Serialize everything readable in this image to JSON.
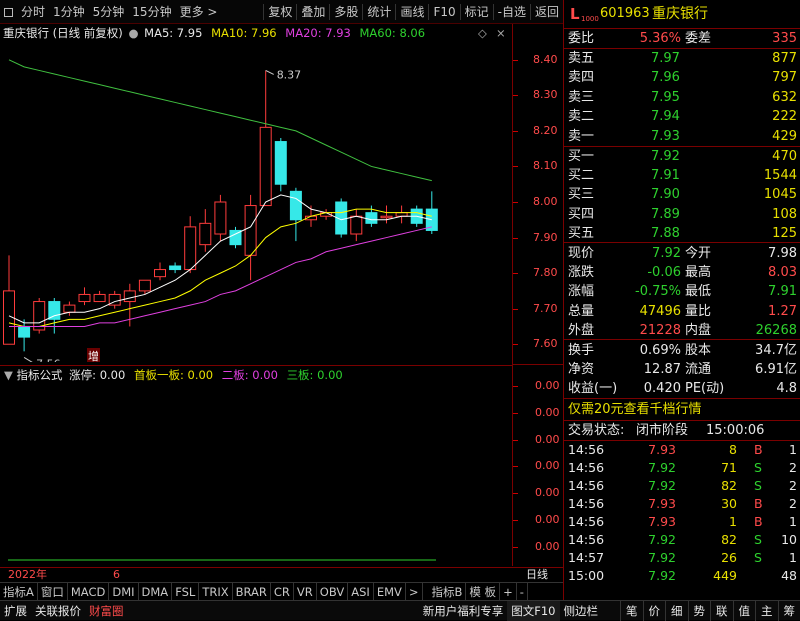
{
  "toolbar": {
    "items": [
      "分时",
      "1分钟",
      "5分钟",
      "15分钟",
      "更多 >",
      "复权",
      "叠加",
      "多股",
      "统计",
      "画线",
      "F10",
      "标记",
      "-自选",
      "返回"
    ]
  },
  "chart_header": {
    "title": "重庆银行 (日线 前复权)",
    "ma5": "MA5: 7.95",
    "ma10": "MA10: 7.96",
    "ma20": "MA20: 7.93",
    "ma60": "MA60: 8.06"
  },
  "chart_data": {
    "type": "candlestick",
    "price_ticks": [
      "8.40",
      "8.30",
      "8.20",
      "8.10",
      "8.00",
      "7.90",
      "7.80",
      "7.70",
      "7.60"
    ],
    "ylim": [
      7.55,
      8.45
    ],
    "candles": [
      {
        "o": 7.6,
        "c": 7.75,
        "h": 7.85,
        "l": 7.6
      },
      {
        "o": 7.65,
        "c": 7.62,
        "h": 7.67,
        "l": 7.58
      },
      {
        "o": 7.64,
        "c": 7.72,
        "h": 7.73,
        "l": 7.63
      },
      {
        "o": 7.72,
        "c": 7.67,
        "h": 7.73,
        "l": 7.63
      },
      {
        "o": 7.69,
        "c": 7.71,
        "h": 7.72,
        "l": 7.68
      },
      {
        "o": 7.72,
        "c": 7.74,
        "h": 7.76,
        "l": 7.71
      },
      {
        "o": 7.72,
        "c": 7.74,
        "h": 7.75,
        "l": 7.72
      },
      {
        "o": 7.71,
        "c": 7.74,
        "h": 7.75,
        "l": 7.7
      },
      {
        "o": 7.72,
        "c": 7.75,
        "h": 7.77,
        "l": 7.65
      },
      {
        "o": 7.75,
        "c": 7.78,
        "h": 7.78,
        "l": 7.74
      },
      {
        "o": 7.79,
        "c": 7.81,
        "h": 7.83,
        "l": 7.78
      },
      {
        "o": 7.82,
        "c": 7.81,
        "h": 7.83,
        "l": 7.8
      },
      {
        "o": 7.81,
        "c": 7.93,
        "h": 7.96,
        "l": 7.8
      },
      {
        "o": 7.88,
        "c": 7.94,
        "h": 7.98,
        "l": 7.86
      },
      {
        "o": 7.91,
        "c": 8.0,
        "h": 8.02,
        "l": 7.89
      },
      {
        "o": 7.92,
        "c": 7.88,
        "h": 7.93,
        "l": 7.87
      },
      {
        "o": 7.85,
        "c": 7.99,
        "h": 8.02,
        "l": 7.78
      },
      {
        "o": 7.99,
        "c": 8.21,
        "h": 8.37,
        "l": 7.99
      },
      {
        "o": 8.17,
        "c": 8.05,
        "h": 8.18,
        "l": 8.03
      },
      {
        "o": 8.03,
        "c": 7.95,
        "h": 8.04,
        "l": 7.89
      },
      {
        "o": 7.95,
        "c": 7.96,
        "h": 7.99,
        "l": 7.93
      },
      {
        "o": 7.96,
        "c": 7.97,
        "h": 7.98,
        "l": 7.95
      },
      {
        "o": 8.0,
        "c": 7.91,
        "h": 8.01,
        "l": 7.9
      },
      {
        "o": 7.91,
        "c": 7.96,
        "h": 7.98,
        "l": 7.89
      },
      {
        "o": 7.97,
        "c": 7.94,
        "h": 7.99,
        "l": 7.93
      },
      {
        "o": 7.96,
        "c": 7.96,
        "h": 7.99,
        "l": 7.94
      },
      {
        "o": 7.96,
        "c": 7.97,
        "h": 7.99,
        "l": 7.94
      },
      {
        "o": 7.98,
        "c": 7.94,
        "h": 7.99,
        "l": 7.93
      },
      {
        "o": 7.98,
        "c": 7.92,
        "h": 8.03,
        "l": 7.91
      }
    ],
    "ma_series": [
      {
        "name": "MA5",
        "color": "#ffffff",
        "values": [
          7.68,
          7.66,
          7.66,
          7.68,
          7.69,
          7.69,
          7.7,
          7.72,
          7.73,
          7.74,
          7.76,
          7.78,
          7.81,
          7.85,
          7.89,
          7.91,
          7.93,
          8.0,
          8.02,
          8.01,
          7.98,
          7.97,
          7.95,
          7.96,
          7.95,
          7.95,
          7.96,
          7.96,
          7.95
        ]
      },
      {
        "name": "MA10",
        "color": "#ffff00",
        "values": [
          7.66,
          7.65,
          7.65,
          7.66,
          7.67,
          7.67,
          7.68,
          7.69,
          7.7,
          7.71,
          7.72,
          7.73,
          7.75,
          7.78,
          7.8,
          7.82,
          7.85,
          7.9,
          7.93,
          7.94,
          7.96,
          7.97,
          7.97,
          7.98,
          7.98,
          7.97,
          7.97,
          7.97,
          7.96
        ]
      },
      {
        "name": "MA20",
        "color": "#e040e0",
        "values": [
          7.65,
          7.65,
          7.65,
          7.65,
          7.65,
          7.65,
          7.66,
          7.66,
          7.67,
          7.68,
          7.69,
          7.7,
          7.71,
          7.72,
          7.74,
          7.75,
          7.77,
          7.79,
          7.81,
          7.83,
          7.84,
          7.86,
          7.87,
          7.88,
          7.89,
          7.9,
          7.91,
          7.92,
          7.93
        ]
      },
      {
        "name": "MA60",
        "color": "#40c040",
        "values": [
          8.4,
          8.38,
          8.37,
          8.36,
          8.35,
          8.34,
          8.33,
          8.32,
          8.31,
          8.3,
          8.29,
          8.28,
          8.27,
          8.26,
          8.25,
          8.24,
          8.23,
          8.22,
          8.21,
          8.2,
          8.18,
          8.16,
          8.14,
          8.12,
          8.1,
          8.09,
          8.08,
          8.07,
          8.06
        ]
      }
    ],
    "annotations": {
      "high": "8.37",
      "low": "7.56",
      "zeng": "增"
    }
  },
  "indicator_header": {
    "name": "指标公式",
    "zt": "涨停: 0.00",
    "sb": "首板一板: 0.00",
    "eb": "二板: 0.00",
    "san": "三板: 0.00"
  },
  "indicator_ticks": [
    "0.00",
    "0.00",
    "0.00",
    "0.00",
    "0.00",
    "0.00",
    "0.00"
  ],
  "date_strip": {
    "year": "2022年",
    "month": "6",
    "right": "日线"
  },
  "bottom_tabs": [
    "指标A",
    "窗口",
    "MACD",
    "DMI",
    "DMA",
    "FSL",
    "TRIX",
    "BRAR",
    "CR",
    "VR",
    "OBV",
    "ASI",
    "EMV",
    ">",
    "指标B",
    "模 板",
    "+",
    "-"
  ],
  "status_bar": {
    "left": [
      "扩展",
      "关联报价",
      "财富圈"
    ],
    "right": [
      "新用户福利专享",
      "图文F10",
      "侧边栏"
    ],
    "icons": [
      "笔",
      "价",
      "细",
      "势",
      "联",
      "值",
      "主",
      "筹"
    ]
  },
  "quote": {
    "flag": "L",
    "flag_sub": "1000",
    "code": "601963",
    "name": "重庆银行",
    "weibi_label": "委比",
    "weibi": "5.36%",
    "weicha_label": "委差",
    "weicha": "335",
    "asks": [
      {
        "label": "卖五",
        "price": "7.97",
        "vol": "877"
      },
      {
        "label": "卖四",
        "price": "7.96",
        "vol": "797"
      },
      {
        "label": "卖三",
        "price": "7.95",
        "vol": "632"
      },
      {
        "label": "卖二",
        "price": "7.94",
        "vol": "222"
      },
      {
        "label": "卖一",
        "price": "7.93",
        "vol": "429"
      }
    ],
    "bids": [
      {
        "label": "买一",
        "price": "7.92",
        "vol": "470"
      },
      {
        "label": "买二",
        "price": "7.91",
        "vol": "1544"
      },
      {
        "label": "买三",
        "price": "7.90",
        "vol": "1045"
      },
      {
        "label": "买四",
        "price": "7.89",
        "vol": "108"
      },
      {
        "label": "买五",
        "price": "7.88",
        "vol": "125"
      }
    ],
    "stats": [
      {
        "l1": "现价",
        "v1": "7.92",
        "c1": "green",
        "l2": "今开",
        "v2": "7.98",
        "c2": "white"
      },
      {
        "l1": "涨跌",
        "v1": "-0.06",
        "c1": "green",
        "l2": "最高",
        "v2": "8.03",
        "c2": "red"
      },
      {
        "l1": "涨幅",
        "v1": "-0.75%",
        "c1": "green",
        "l2": "最低",
        "v2": "7.91",
        "c2": "green"
      },
      {
        "l1": "总量",
        "v1": "47496",
        "c1": "yellow",
        "l2": "量比",
        "v2": "1.27",
        "c2": "red"
      },
      {
        "l1": "外盘",
        "v1": "21228",
        "c1": "red",
        "l2": "内盘",
        "v2": "26268",
        "c2": "green"
      }
    ],
    "stats2": [
      {
        "l1": "换手",
        "v1": "0.69%",
        "l2": "股本",
        "v2": "34.7亿"
      },
      {
        "l1": "净资",
        "v1": "12.87",
        "l2": "流通",
        "v2": "6.91亿"
      },
      {
        "l1": "收益(一)",
        "v1": "0.420",
        "l2": "PE(动)",
        "v2": "4.8"
      }
    ],
    "promo": "仅需20元查看千档行情",
    "trade_status_label": "交易状态:",
    "trade_status": "闭市阶段",
    "trade_time": "15:00:06",
    "ticks": [
      {
        "t": "14:56",
        "p": "7.93",
        "pc": "red",
        "v": "8",
        "bs": "B",
        "n": "1"
      },
      {
        "t": "14:56",
        "p": "7.92",
        "pc": "green",
        "v": "71",
        "bs": "S",
        "n": "2"
      },
      {
        "t": "14:56",
        "p": "7.92",
        "pc": "green",
        "v": "82",
        "bs": "S",
        "n": "2"
      },
      {
        "t": "14:56",
        "p": "7.93",
        "pc": "red",
        "v": "30",
        "bs": "B",
        "n": "2"
      },
      {
        "t": "14:56",
        "p": "7.93",
        "pc": "red",
        "v": "1",
        "bs": "B",
        "n": "1"
      },
      {
        "t": "14:56",
        "p": "7.92",
        "pc": "green",
        "v": "82",
        "bs": "S",
        "n": "10"
      },
      {
        "t": "14:57",
        "p": "7.92",
        "pc": "green",
        "v": "26",
        "bs": "S",
        "n": "1"
      },
      {
        "t": "15:00",
        "p": "7.92",
        "pc": "green",
        "v": "449",
        "bs": "",
        "n": "48"
      }
    ]
  },
  "colors": {
    "up": "#ff3c3c",
    "down": "#36e8e8",
    "grid_red": "#7a0000"
  }
}
